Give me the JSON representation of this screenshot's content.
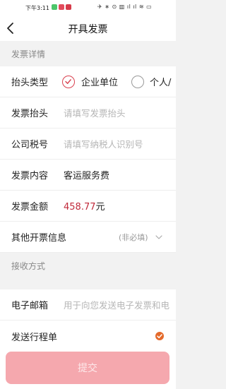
{
  "status_bar": {
    "time": "下午3:11",
    "icons": "✈ ∗ ⊙ ▥ ıl ıl ≋ ▭"
  },
  "navbar": {
    "title": "开具发票"
  },
  "sections": {
    "invoice_details": "发票详情",
    "receive_method": "接收方式"
  },
  "form": {
    "header_type": {
      "label": "抬头类型",
      "options": [
        "企业单位",
        "个人/"
      ],
      "selected": "企业单位"
    },
    "invoice_title": {
      "label": "发票抬头",
      "placeholder": "请填写发票抬头"
    },
    "tax_number": {
      "label": "公司税号",
      "placeholder": "请填写纳税人识别号"
    },
    "content": {
      "label": "发票内容",
      "value": "客运服务费"
    },
    "amount": {
      "label": "发票金额",
      "value": "458.77",
      "unit": "元"
    },
    "other_info": {
      "label": "其他开票信息",
      "hint": "(非必填)"
    },
    "email": {
      "label": "电子邮箱",
      "placeholder": "用于向您发送电子发票和电"
    },
    "itinerary": {
      "label": "发送行程单",
      "checked": true
    }
  },
  "submit": {
    "label": "提交"
  },
  "colors": {
    "accent": "#d9414f",
    "amount": "#c0293a",
    "submit_disabled": "#f5a8ae",
    "check": "#e46a2b"
  }
}
